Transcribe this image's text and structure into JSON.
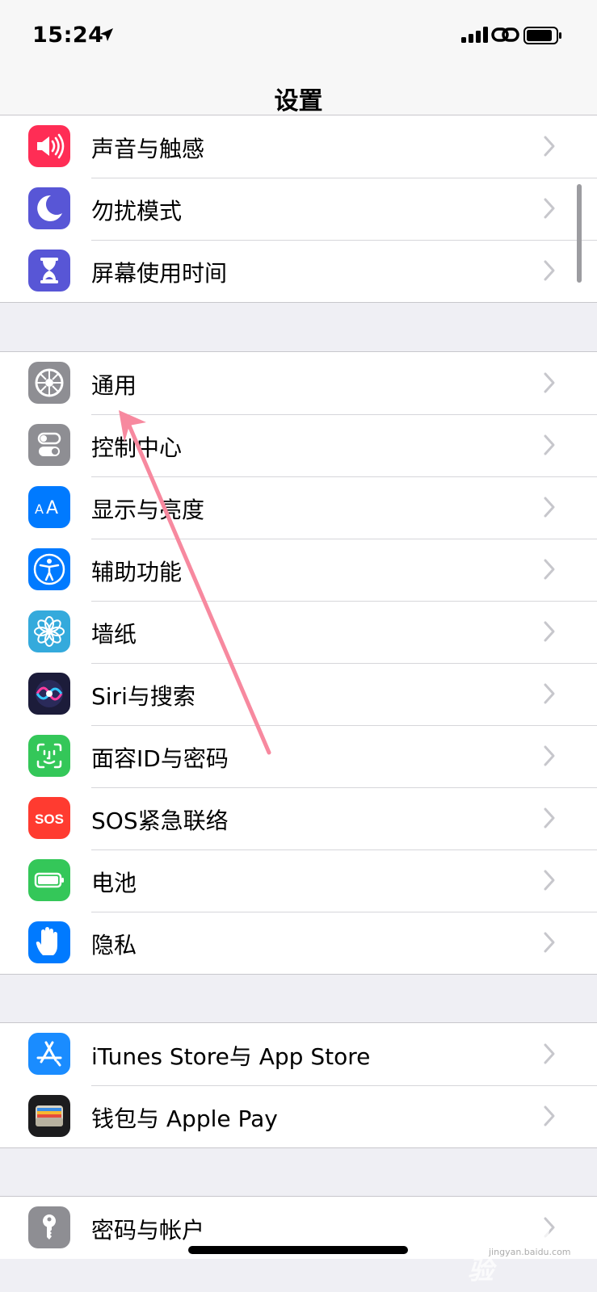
{
  "status_bar": {
    "time": "15:24"
  },
  "nav": {
    "title": "设置"
  },
  "groups": [
    {
      "items": [
        {
          "label": "声音与触感",
          "icon": "speaker-icon",
          "color": "#ff2d55"
        },
        {
          "label": "勿扰模式",
          "icon": "moon-icon",
          "color": "#5856d6"
        },
        {
          "label": "屏幕使用时间",
          "icon": "hourglass-icon",
          "color": "#5856d6"
        }
      ]
    },
    {
      "items": [
        {
          "label": "通用",
          "icon": "gear-icon",
          "color": "#8e8e93"
        },
        {
          "label": "控制中心",
          "icon": "toggles-icon",
          "color": "#8e8e93"
        },
        {
          "label": "显示与亮度",
          "icon": "text-size-icon",
          "color": "#007aff"
        },
        {
          "label": "辅助功能",
          "icon": "accessibility-icon",
          "color": "#007aff"
        },
        {
          "label": "墙纸",
          "icon": "flower-icon",
          "color": "#34aadc"
        },
        {
          "label": "Siri与搜索",
          "icon": "siri-icon",
          "color": "#1c1c3a"
        },
        {
          "label": "面容ID与密码",
          "icon": "face-id-icon",
          "color": "#34c759"
        },
        {
          "label": "SOS紧急联络",
          "icon": "sos-icon",
          "color": "#ff3b30"
        },
        {
          "label": "电池",
          "icon": "battery-icon",
          "color": "#34c759"
        },
        {
          "label": "隐私",
          "icon": "hand-icon",
          "color": "#007aff"
        }
      ]
    },
    {
      "items": [
        {
          "label": "iTunes Store与 App Store",
          "icon": "app-store-icon",
          "color": "#1a8cff"
        },
        {
          "label": "钱包与 Apple Pay",
          "icon": "wallet-icon",
          "color": "#1c1c1e"
        }
      ]
    },
    {
      "items": [
        {
          "label": "密码与帐户",
          "icon": "key-icon",
          "color": "#8e8e93"
        }
      ]
    }
  ],
  "watermark": {
    "logo_text": "Baidu经验",
    "url_text": "jingyan.baidu.com"
  }
}
